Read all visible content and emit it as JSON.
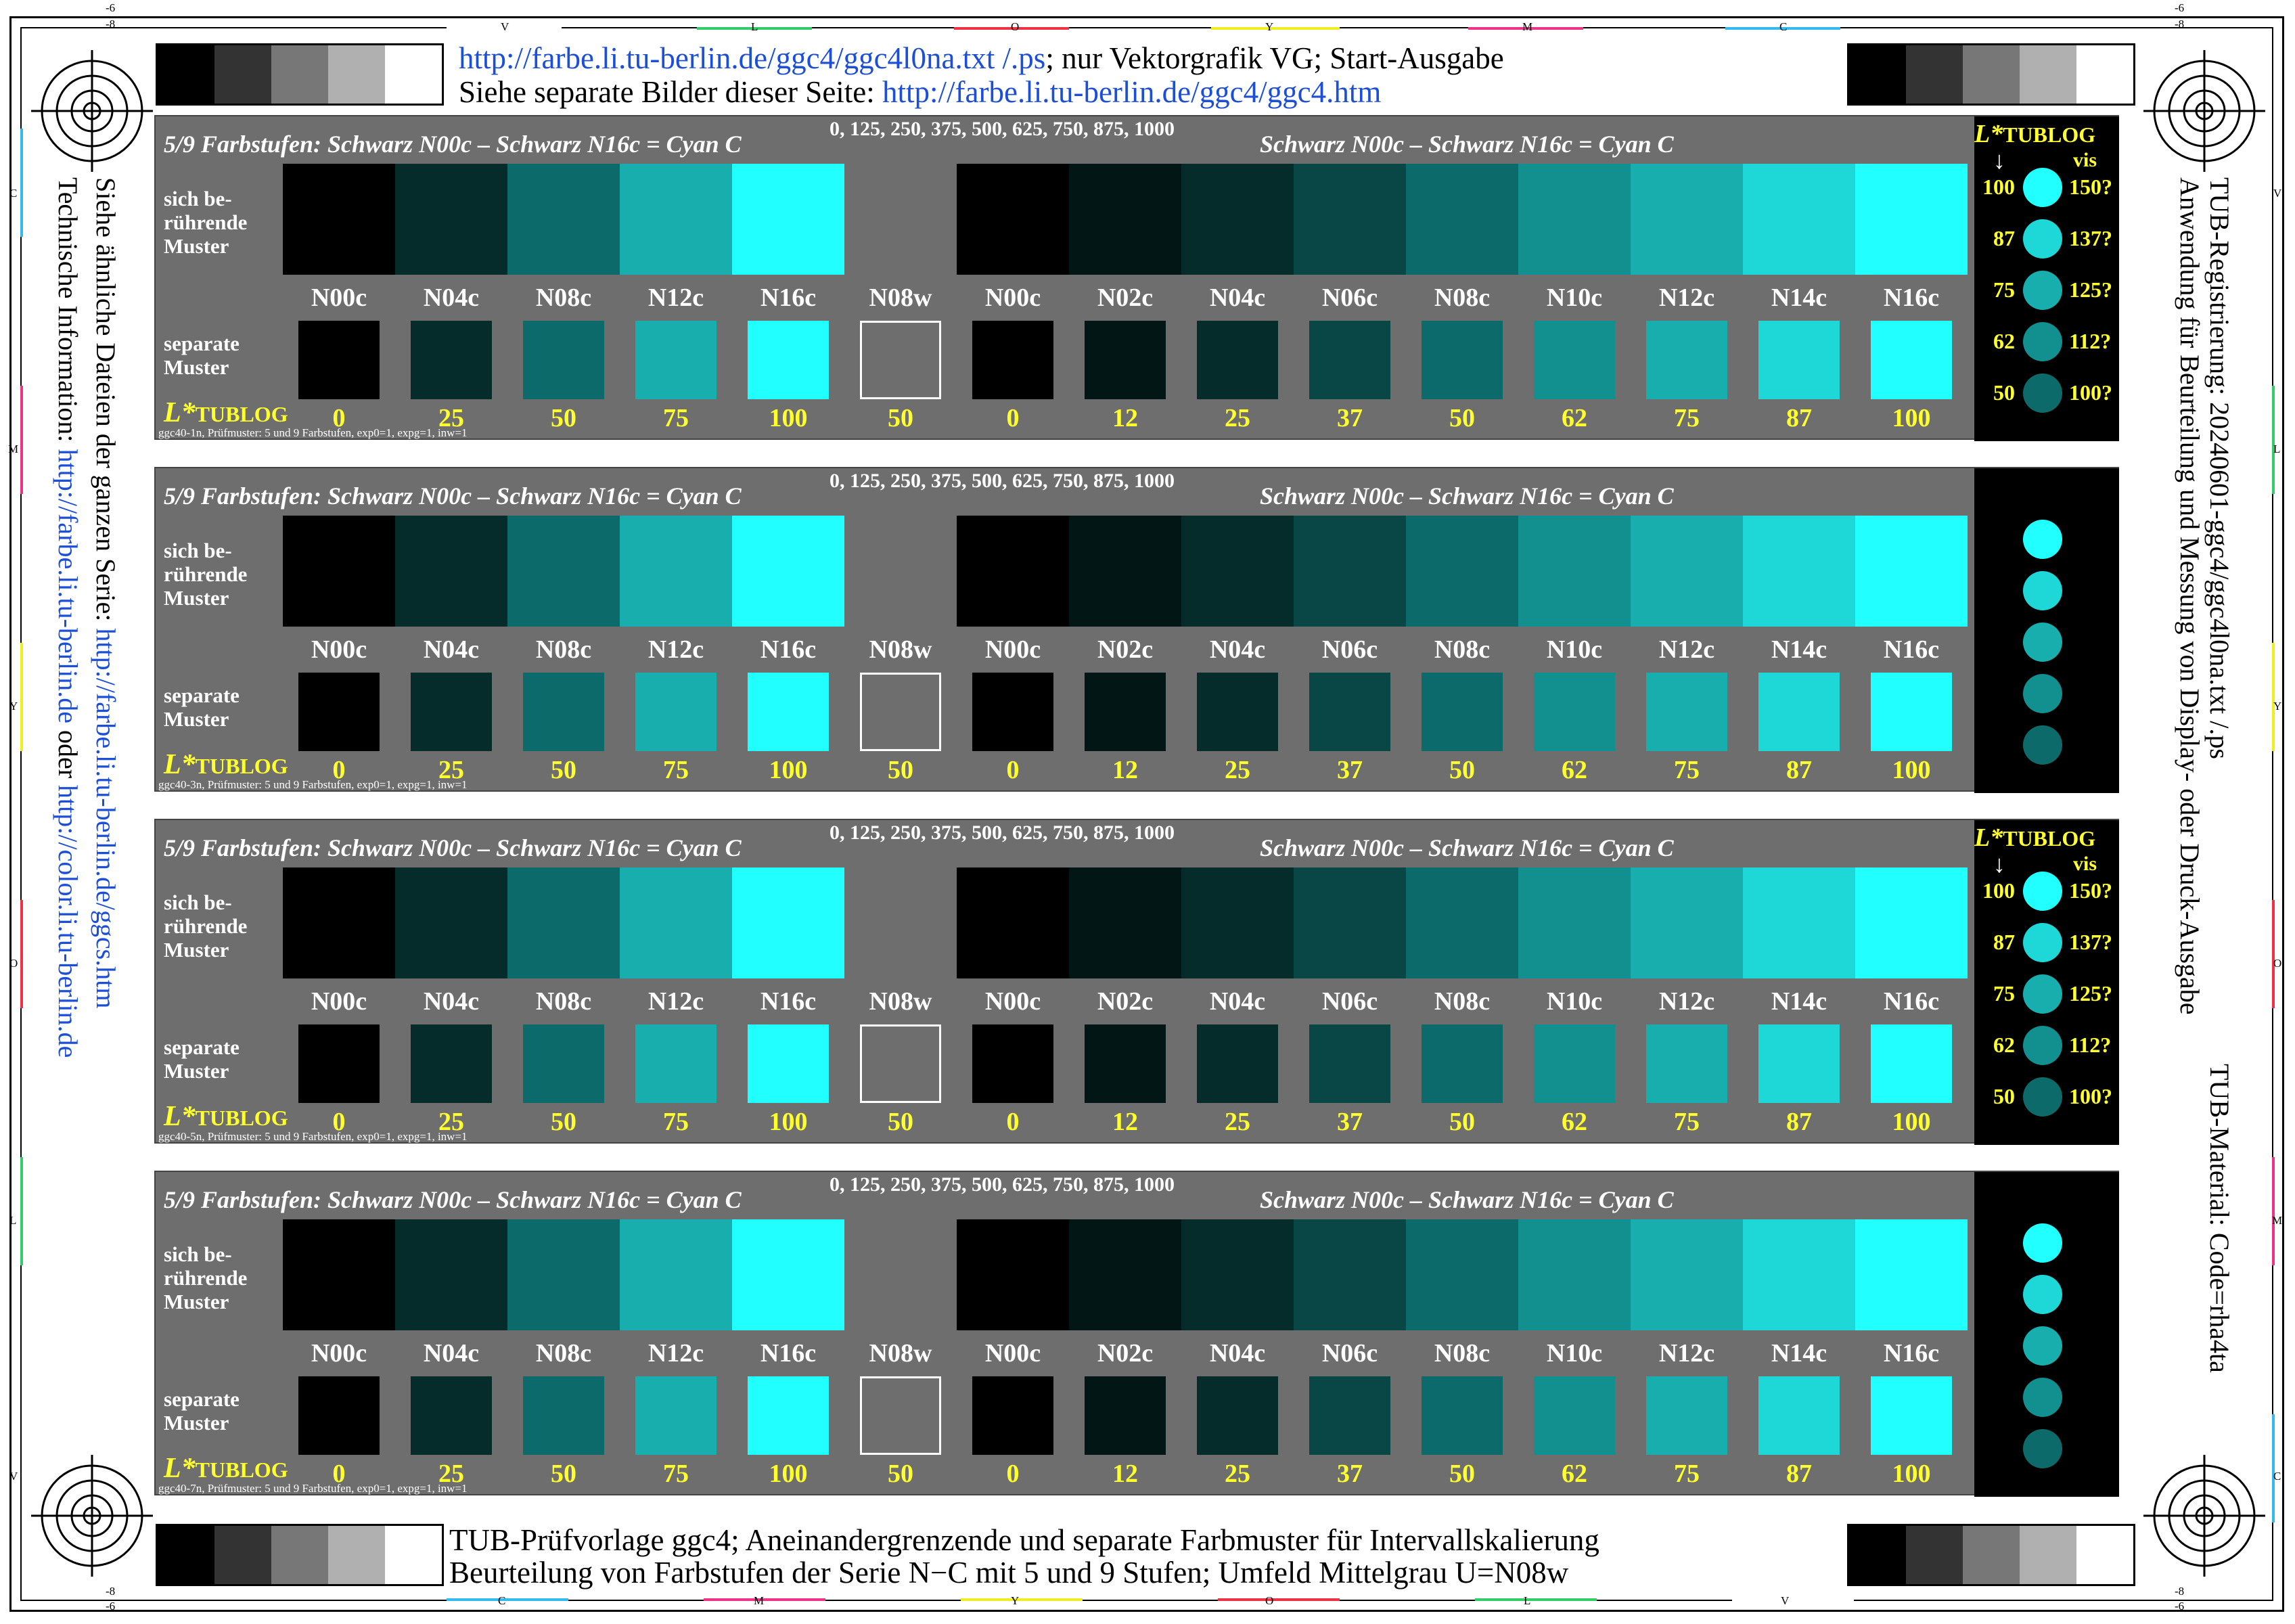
{
  "header": {
    "line1_link": "http://farbe.li.tu-berlin.de/ggc4/ggc4l0na.txt /.ps",
    "line1_rest": "; nur Vektorgrafik VG; Start-Ausgabe",
    "line2_text": "Siehe separate Bilder dieser Seite: ",
    "line2_link": "http://farbe.li.tu-berlin.de/ggc4/ggc4.htm"
  },
  "footer": {
    "line1": "TUB-Prüfvorlage ggc4; Aneinandergrenzende und separate Farbmuster für Intervallskalierung",
    "line2": "Beurteilung von Farbstufen der Serie N−C mit 5 und 9 Stufen; Umfeld Mittelgrau U=N08w"
  },
  "left_side": {
    "line1_text": "Siehe ähnliche Dateien der ganzen Serie: ",
    "line1_link": "http://farbe.li.tu-berlin.de/ggcs.htm",
    "line2_text": "Technische Information: ",
    "line2_link1": "http://farbe.li.tu-berlin.de",
    "line2_mid": " oder ",
    "line2_link2": "http://color.li.tu-berlin.de"
  },
  "right_side": {
    "line1": "TUB-Registrierung: 20240601-ggc4/ggc4l0na.txt /.ps",
    "line2": "Anwendung für Beurteilung und Messung von Display- oder Druck-Ausgabe",
    "line3": "TUB-Material: Code=rha4ta"
  },
  "edge_marks": {
    "top_corner_left": "-6",
    "top_corner_left2": "-8",
    "top_corner_right": "-6",
    "top_corner_right2": "-8",
    "bottom_corner_left": "-8",
    "bottom_corner_left2": "-6",
    "bottom_corner_right": "-8",
    "bottom_corner_right2": "-6",
    "top": [
      "V",
      "L",
      "O",
      "Y",
      "M",
      "C"
    ],
    "bottom": [
      "C",
      "M",
      "Y",
      "O",
      "L",
      "V"
    ],
    "left": [
      "C",
      "M",
      "Y",
      "O",
      "L",
      "V"
    ],
    "right": [
      "V",
      "L",
      "Y",
      "O",
      "M",
      "C"
    ]
  },
  "colors": {
    "panel_bg": "#6e6e6e",
    "label_yellow": "#ffff30",
    "link_blue": "#1d4fd6",
    "grey_steps": [
      "#000000",
      "#333333",
      "#777777",
      "#b0b0b0",
      "#ffffff"
    ],
    "five_steps": [
      "#000000",
      "#052b2b",
      "#0d6a6a",
      "#19aeae",
      "#22ffff"
    ],
    "nine_steps": [
      "#000000",
      "#031616",
      "#052b2b",
      "#094747",
      "#0d6a6a",
      "#128f8f",
      "#19aeae",
      "#1ed8d8",
      "#22ffff"
    ],
    "middle_grey": "#6e6e6e"
  },
  "panel_common": {
    "title_left": "5/9 Farbstufen:  Schwarz N00c – Schwarz N16c = Cyan C",
    "title_right": "Schwarz N00c – Schwarz N16c = Cyan C",
    "steps": "0, 125, 250, 375, 500, 625, 750, 875, 1000",
    "row1_label": [
      "sich be-",
      "rührende",
      "Muster"
    ],
    "row2_label": [
      "separate",
      "Muster"
    ],
    "ltub_main": "L*",
    "ltub_sub": "TUBLOG",
    "codes": [
      "N00c",
      "N04c",
      "N08c",
      "N12c",
      "N16c",
      "N08w",
      "N00c",
      "N02c",
      "N04c",
      "N06c",
      "N08c",
      "N10c",
      "N12c",
      "N14c",
      "N16c"
    ],
    "lvalues": [
      "0",
      "25",
      "50",
      "75",
      "100",
      "50",
      "0",
      "12",
      "25",
      "37",
      "50",
      "62",
      "75",
      "87",
      "100"
    ]
  },
  "panels": [
    {
      "footnote": "ggc40-1n, Prüfmuster: 5 und 9 Farbstufen, exp0=1, expg=1, inw=1",
      "legend_labels": true
    },
    {
      "footnote": "ggc40-3n, Prüfmuster: 5 und 9 Farbstufen, exp0=1, expg=1, inw=1",
      "legend_labels": false
    },
    {
      "footnote": "ggc40-5n, Prüfmuster: 5 und 9 Farbstufen, exp0=1, expg=1, inw=1",
      "legend_labels": true
    },
    {
      "footnote": "ggc40-7n, Prüfmuster: 5 und 9 Farbstufen, exp0=1, expg=1, inw=1",
      "legend_labels": false
    }
  ],
  "legend": {
    "head_main": "L*",
    "head_sub": "TUBLOG",
    "vis": "vis",
    "arrow": "↓",
    "left": [
      "100",
      "87",
      "75",
      "62",
      "50"
    ],
    "right": [
      "150?",
      "137?",
      "125?",
      "112?",
      "100?"
    ],
    "circle_colors": [
      "#22ffff",
      "#1ed8d8",
      "#19aeae",
      "#128f8f",
      "#0d6a6a"
    ]
  }
}
